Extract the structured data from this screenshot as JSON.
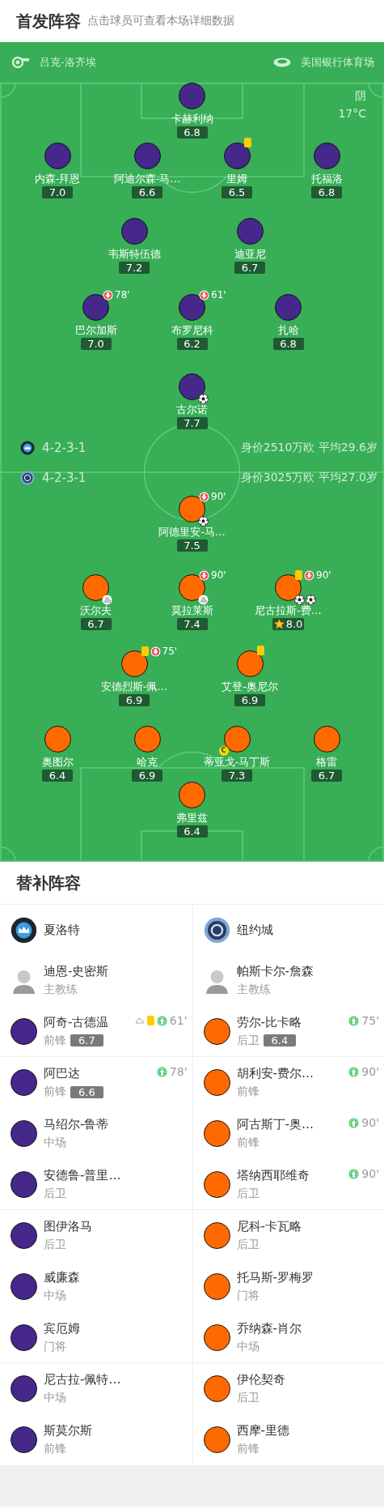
{
  "header": {
    "title": "首发阵容",
    "hint": "点击球员可查看本场详细数据"
  },
  "pitch": {
    "referee": "吕克-洛齐埃",
    "venue": "美国银行体育场",
    "weather": "阴",
    "temperature": "17°C",
    "home": {
      "color": "#45288a",
      "formation": "4-2-3-1",
      "info": "身价2510万欧 平均29.6岁",
      "rows": [
        [
          {
            "name": "卡赫利纳",
            "rating": "6.8"
          }
        ],
        [
          {
            "name": "内森-拜恩",
            "rating": "7.0"
          },
          {
            "name": "阿迪尔森-马…",
            "rating": "6.6"
          },
          {
            "name": "里姆",
            "rating": "6.5",
            "yellow_card": true
          },
          {
            "name": "托福洛",
            "rating": "6.8"
          }
        ],
        [
          {
            "name": "韦斯特伍德",
            "rating": "7.2"
          },
          {
            "name": "迪亚尼",
            "rating": "6.7"
          }
        ],
        [
          {
            "name": "巴尔加斯",
            "rating": "7.0",
            "sub_off": "78'"
          },
          {
            "name": "布罗尼科",
            "rating": "6.2",
            "sub_off": "61'"
          },
          {
            "name": "扎哈",
            "rating": "6.8"
          }
        ],
        [
          {
            "name": "古尔诺",
            "rating": "7.7",
            "badges": [
              {
                "kind": "goal"
              }
            ]
          }
        ]
      ]
    },
    "away": {
      "color": "#ff6a00",
      "formation": "4-2-3-1",
      "info": "身价3025万欧 平均27.0岁",
      "rows": [
        [
          {
            "name": "阿德里安-马…",
            "rating": "7.5",
            "sub_off": "90'",
            "badges": [
              {
                "kind": "goal"
              }
            ]
          }
        ],
        [
          {
            "name": "沃尔夫",
            "rating": "6.7",
            "badges": [
              {
                "kind": "assist"
              }
            ]
          },
          {
            "name": "莫拉莱斯",
            "rating": "7.4",
            "sub_off": "90'",
            "badges": [
              {
                "kind": "assist"
              }
            ]
          },
          {
            "name": "尼古拉斯-费…",
            "rating": "8.0",
            "best": true,
            "yellow_card": true,
            "sub_off": "90'",
            "badges": [
              {
                "kind": "goal"
              },
              {
                "kind": "goal"
              }
            ]
          }
        ],
        [
          {
            "name": "安德烈斯-佩…",
            "rating": "6.9",
            "yellow_card": true,
            "sub_off": "75'"
          },
          {
            "name": "艾登-奥尼尔",
            "rating": "6.9",
            "yellow_card": true
          }
        ],
        [
          {
            "name": "奥图尔",
            "rating": "6.4"
          },
          {
            "name": "哈克",
            "rating": "6.9"
          },
          {
            "name": "蒂亚戈-马丁斯",
            "rating": "7.3",
            "captain": "C"
          },
          {
            "name": "格雷",
            "rating": "6.7"
          }
        ],
        [
          {
            "name": "弗里兹",
            "rating": "6.4"
          }
        ]
      ]
    }
  },
  "subs": {
    "title": "替补阵容",
    "teams": [
      {
        "name": "夏洛特",
        "color": "#45288a",
        "coach": {
          "name": "迪恩-史密斯",
          "role": "主教练"
        },
        "players": [
          {
            "name": "阿奇-古德温",
            "position": "前锋",
            "rating": "6.7",
            "assist": true,
            "yellow_card": true,
            "sub_on": "61'",
            "divider": true
          },
          {
            "name": "阿巴达",
            "position": "前锋",
            "rating": "6.6",
            "sub_on": "78'",
            "divider": false
          },
          {
            "name": "马绍尔-鲁蒂",
            "position": "中场",
            "divider": false
          },
          {
            "name": "安德鲁-普里…",
            "position": "后卫",
            "divider": true
          },
          {
            "name": "图伊洛马",
            "position": "后卫",
            "divider": false
          },
          {
            "name": "威廉森",
            "position": "中场",
            "divider": false
          },
          {
            "name": "宾厄姆",
            "position": "门将",
            "divider": true
          },
          {
            "name": "尼古拉-佩特…",
            "position": "中场",
            "divider": false
          },
          {
            "name": "斯莫尔斯",
            "position": "前锋",
            "divider": false
          }
        ]
      },
      {
        "name": "纽约城",
        "color": "#ff6a00",
        "coach": {
          "name": "帕斯卡尔-詹森",
          "role": "主教练"
        },
        "players": [
          {
            "name": "劳尔-比卡略",
            "position": "后卫",
            "rating": "6.4",
            "sub_on": "75'",
            "divider": true
          },
          {
            "name": "胡利安-费尔…",
            "position": "前锋",
            "sub_on": "90'",
            "divider": false
          },
          {
            "name": "阿古斯丁-奥…",
            "position": "前锋",
            "sub_on": "90'",
            "divider": false
          },
          {
            "name": "塔纳西耶维奇",
            "position": "后卫",
            "sub_on": "90'",
            "divider": true
          },
          {
            "name": "尼科-卡瓦略",
            "position": "后卫",
            "divider": false
          },
          {
            "name": "托马斯-罗梅罗",
            "position": "门将",
            "divider": false
          },
          {
            "name": "乔纳森-肖尔",
            "position": "中场",
            "divider": true
          },
          {
            "name": "伊伦契奇",
            "position": "后卫",
            "divider": false
          },
          {
            "name": "西摩-里德",
            "position": "前锋",
            "divider": false
          }
        ]
      }
    ]
  }
}
